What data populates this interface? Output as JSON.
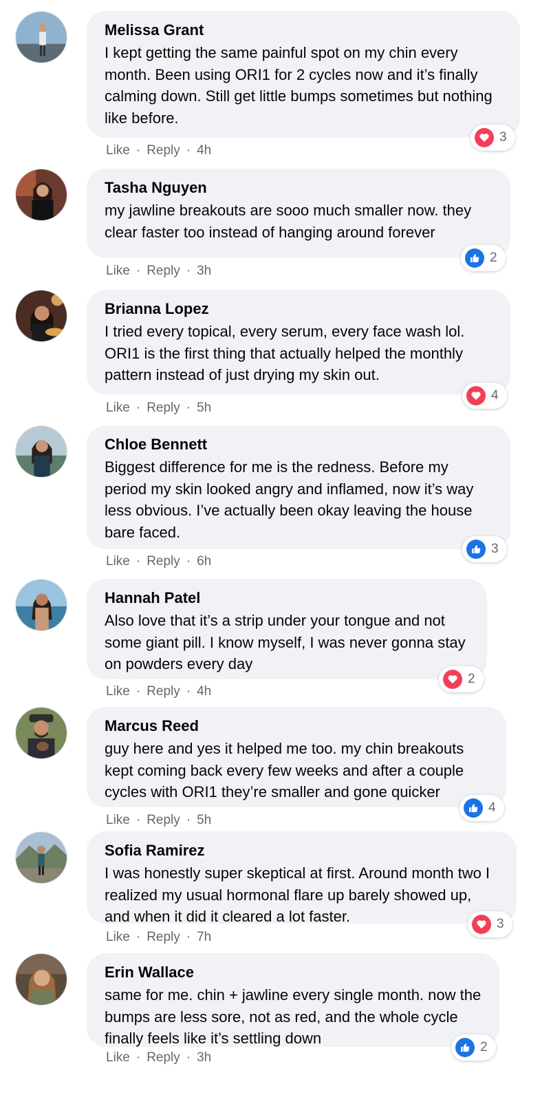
{
  "comments": [
    {
      "author": "Melissa Grant",
      "text": "I kept getting the same painful spot on my chin every month. Been using ORI1 for 2 cycles now and it’s finally calming down. Still get little bumps sometimes but nothing like before.",
      "like_label": "Like",
      "reply_label": "Reply",
      "time": "4h",
      "reaction": "love-icon",
      "reaction_count": "3"
    },
    {
      "author": "Tasha Nguyen",
      "text": "my jawline breakouts are sooo much smaller now. they clear faster too instead of hanging around forever",
      "like_label": "Like",
      "reply_label": "Reply",
      "time": "3h",
      "reaction": "like-icon",
      "reaction_count": "2"
    },
    {
      "author": "Brianna Lopez",
      "text": "I tried every topical, every serum, every face wash lol. ORI1 is the first thing that actually helped the monthly pattern instead of just drying my skin out.",
      "like_label": "Like",
      "reply_label": "Reply",
      "time": "5h",
      "reaction": "love-icon",
      "reaction_count": "4"
    },
    {
      "author": "Chloe Bennett",
      "text": "Biggest difference for me is the redness. Before my period my skin looked angry and inflamed, now it’s way less obvious. I’ve actually been okay leaving the house bare faced.",
      "like_label": "Like",
      "reply_label": "Reply",
      "time": "6h",
      "reaction": "like-icon",
      "reaction_count": "3"
    },
    {
      "author": "Hannah Patel",
      "text": "Also love that it’s a strip under your tongue and not some giant pill. I know myself, I was never gonna stay on powders every day",
      "like_label": "Like",
      "reply_label": "Reply",
      "time": "4h",
      "reaction": "love-icon",
      "reaction_count": "2"
    },
    {
      "author": "Marcus Reed",
      "text": "guy here and yes it helped me too. my chin breakouts kept coming back every few weeks and after a couple cycles with ORI1 they’re smaller and gone quicker",
      "like_label": "Like",
      "reply_label": "Reply",
      "time": "5h",
      "reaction": "like-icon",
      "reaction_count": "4"
    },
    {
      "author": "Sofia Ramirez",
      "text": "I was honestly super skeptical at first. Around month two I realized my usual hormonal flare up barely showed up, and when it did it cleared a lot faster.",
      "like_label": "Like",
      "reply_label": "Reply",
      "time": "7h",
      "reaction": "love-icon",
      "reaction_count": "3"
    },
    {
      "author": "Erin Wallace",
      "text": "same for me. chin + jawline every single month. now the bumps are less sore, not as red, and the whole cycle finally feels like it’s settling down",
      "like_label": "Like",
      "reply_label": "Reply",
      "time": "3h",
      "reaction": "like-icon",
      "reaction_count": "2"
    }
  ],
  "colors": {
    "bubble": "#f0f2f5",
    "meta_text": "#65676b",
    "love": "#f33e58",
    "like": "#1b74e4"
  }
}
